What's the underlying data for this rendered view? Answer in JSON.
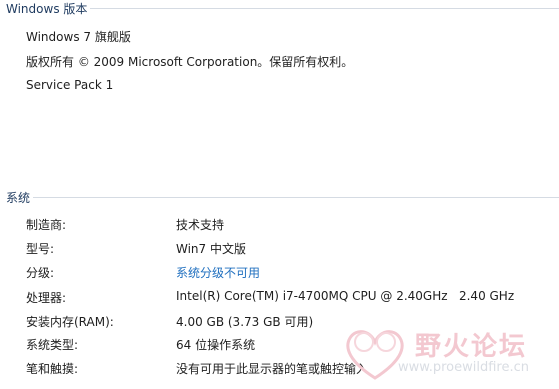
{
  "windows_edition": {
    "header": "Windows 版本",
    "edition": "Windows 7 旗舰版",
    "copyright": "版权所有 © 2009 Microsoft Corporation。保留所有权利。",
    "service_pack": "Service Pack 1"
  },
  "system": {
    "header": "系统",
    "rows": [
      {
        "label": "制造商:",
        "value": "技术支持"
      },
      {
        "label": "型号:",
        "value": "Win7 中文版"
      },
      {
        "label": "分级:",
        "value": "系统分级不可用",
        "link": true
      },
      {
        "label": "处理器:",
        "value": "Intel(R) Core(TM) i7-4700MQ CPU @ 2.40GHz   2.40 GHz"
      },
      {
        "label": "安装内存(RAM):",
        "value": "4.00 GB (3.73 GB 可用)"
      },
      {
        "label": "系统类型:",
        "value": "64 位操作系统"
      },
      {
        "label": "笔和触摸:",
        "value": "没有可用于此显示器的笔或触控输入"
      }
    ]
  },
  "watermark": {
    "text": "野火论坛",
    "url": "www.proewildfire.cn"
  },
  "colors": {
    "header_text": "#1e3a5f",
    "rule": "#d5dbe3",
    "link": "#1f6fbf",
    "watermark": "#f3c8d0"
  }
}
